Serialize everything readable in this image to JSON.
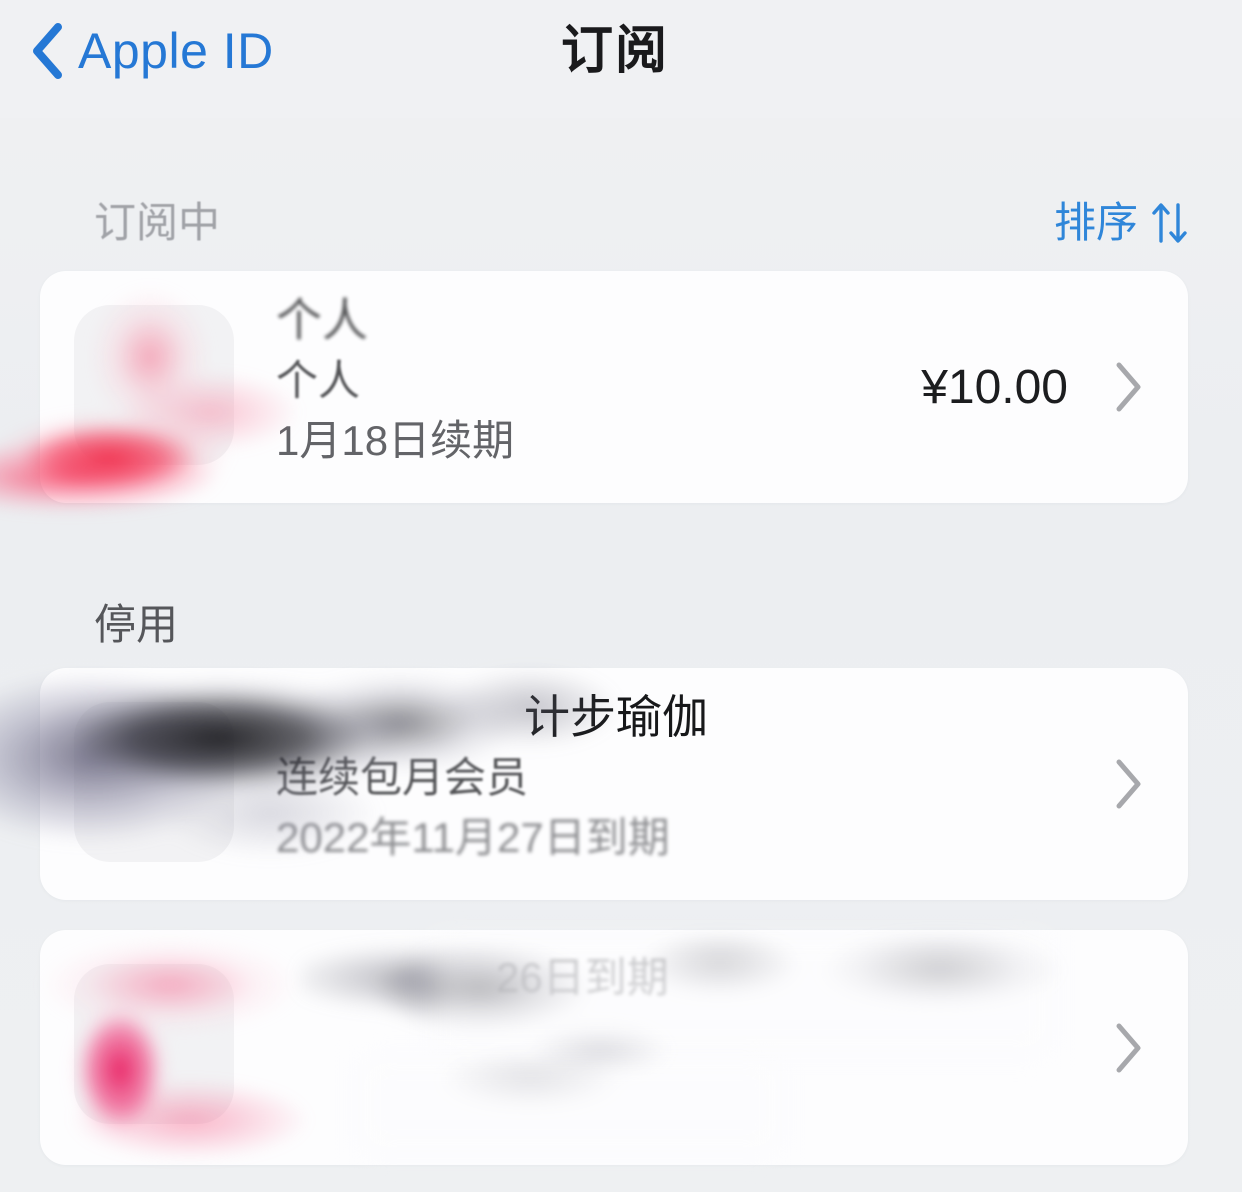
{
  "navbar": {
    "back_label": "Apple ID",
    "back_icon": "chevron-left-icon",
    "title": "订阅"
  },
  "sections": [
    {
      "id": "active",
      "header": "订阅中",
      "sort_label": "排序",
      "sort_icon": "sort-arrows-icon"
    },
    {
      "id": "expired",
      "header": "停用"
    }
  ],
  "active_subscriptions": [
    {
      "title": "个人",
      "subtitle": "个人",
      "meta": "1月18日续期",
      "price": "¥10.00",
      "chevron": "chevron-right-icon",
      "icon": "app-icon-redacted"
    }
  ],
  "expired_subscriptions": [
    {
      "title": "计步瑜伽",
      "subtitle": "连续包月会员",
      "meta": "2022年11月27日到期",
      "price": "",
      "chevron": "chevron-right-icon",
      "icon": "app-icon-redacted"
    },
    {
      "title": "",
      "subtitle": "",
      "meta": "26日到期",
      "price": "",
      "chevron": "chevron-right-icon",
      "icon": "app-icon-redacted"
    }
  ],
  "colors": {
    "page_background": "#eef0f2",
    "card_background": "#fdfdfe",
    "accent_blue": "#2578d5",
    "sort_blue": "#2f86d9",
    "title_text": "#1a1a1c",
    "secondary_text": "#636468",
    "chevron_gray": "#a7a8ac"
  }
}
